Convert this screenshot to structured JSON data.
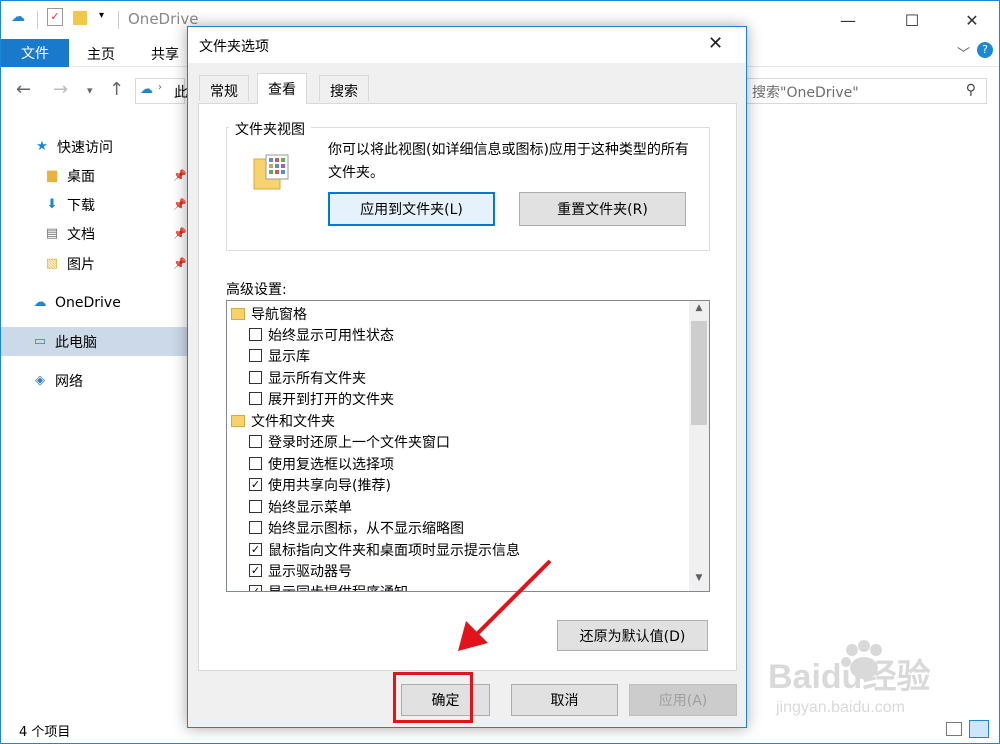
{
  "explorer": {
    "title": "OneDrive",
    "ribbon_tabs": [
      "文件",
      "主页",
      "共享"
    ],
    "address_partial": "此",
    "search_placeholder": "搜索\"OneDrive\"",
    "sidebar": [
      {
        "label": "快速访问",
        "icon": "star-icon"
      },
      {
        "label": "桌面",
        "icon": "desktop-folder-icon",
        "pinned": true
      },
      {
        "label": "下载",
        "icon": "download-folder-icon",
        "pinned": true
      },
      {
        "label": "文档",
        "icon": "documents-folder-icon",
        "pinned": true
      },
      {
        "label": "图片",
        "icon": "pictures-folder-icon",
        "pinned": true
      },
      {
        "label": "OneDrive",
        "icon": "cloud-icon"
      },
      {
        "label": "此电脑",
        "icon": "computer-icon",
        "selected": true
      },
      {
        "label": "网络",
        "icon": "network-icon"
      }
    ],
    "status": "4 个项目"
  },
  "dialog": {
    "title": "文件夹选项",
    "tabs": [
      "常规",
      "查看",
      "搜索"
    ],
    "active_tab": "查看",
    "folder_views": {
      "legend": "文件夹视图",
      "desc": "你可以将此视图(如详细信息或图标)应用于这种类型的所有文件夹。",
      "apply_btn": "应用到文件夹(L)",
      "reset_btn": "重置文件夹(R)"
    },
    "advanced_label": "高级设置:",
    "advanced": [
      {
        "type": "category",
        "label": "导航窗格"
      },
      {
        "type": "check",
        "label": "始终显示可用性状态",
        "checked": false
      },
      {
        "type": "check",
        "label": "显示库",
        "checked": false
      },
      {
        "type": "check",
        "label": "显示所有文件夹",
        "checked": false
      },
      {
        "type": "check",
        "label": "展开到打开的文件夹",
        "checked": false
      },
      {
        "type": "category",
        "label": "文件和文件夹"
      },
      {
        "type": "check",
        "label": "登录时还原上一个文件夹窗口",
        "checked": false
      },
      {
        "type": "check",
        "label": "使用复选框以选择项",
        "checked": false
      },
      {
        "type": "check",
        "label": "使用共享向导(推荐)",
        "checked": true
      },
      {
        "type": "check",
        "label": "始终显示菜单",
        "checked": false
      },
      {
        "type": "check",
        "label": "始终显示图标，从不显示缩略图",
        "checked": false
      },
      {
        "type": "check",
        "label": "鼠标指向文件夹和桌面项时显示提示信息",
        "checked": true
      },
      {
        "type": "check",
        "label": "显示驱动器号",
        "checked": true
      },
      {
        "type": "check",
        "label": "显示同步提供程序通知",
        "checked": true
      }
    ],
    "restore_btn": "还原为默认值(D)",
    "ok_btn": "确定",
    "cancel_btn": "取消",
    "apply_btn": "应用(A)"
  },
  "watermark": {
    "brand": "Baidu经验",
    "url": "jingyan.baidu.com"
  },
  "colors": {
    "accent": "#0078d7",
    "ribbon_file": "#1979ca",
    "highlight": "#e0141a"
  }
}
